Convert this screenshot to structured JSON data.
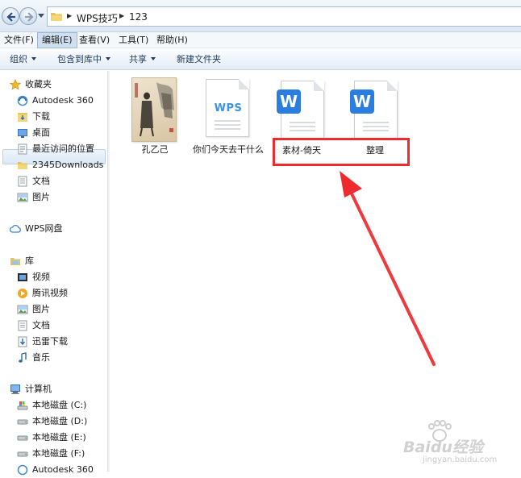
{
  "address": {
    "crumbs": [
      "WPS技巧",
      "123"
    ]
  },
  "menu": [
    {
      "label": "文件(F)"
    },
    {
      "label": "编辑(E)"
    },
    {
      "label": "查看(V)"
    },
    {
      "label": "工具(T)"
    },
    {
      "label": "帮助(H)"
    }
  ],
  "toolbar": {
    "organize": "组织",
    "include_library": "包含到库中",
    "share": "共享",
    "new_folder": "新建文件夹"
  },
  "sidebar": {
    "favorites": {
      "title": "收藏夹",
      "items": [
        "Autodesk 360",
        "下载",
        "桌面",
        "最近访问的位置",
        "2345Downloads",
        "文档",
        "图片"
      ]
    },
    "wps": "WPS网盘",
    "library": {
      "title": "库",
      "items": [
        "视频",
        "腾讯视频",
        "图片",
        "文档",
        "迅雷下载",
        "音乐"
      ]
    },
    "computer": {
      "title": "计算机",
      "items": [
        "本地磁盘 (C:)",
        "本地磁盘 (D:)",
        "本地磁盘 (E:)",
        "本地磁盘 (F:)",
        "Autodesk 360"
      ]
    }
  },
  "files": [
    {
      "name": "孔乙己",
      "kind": "image"
    },
    {
      "name": "你们今天去干什么",
      "kind": "wps-doc"
    },
    {
      "name": "素材-倚天",
      "kind": "word-doc"
    },
    {
      "name": "整理",
      "kind": "word-doc"
    }
  ],
  "colors": {
    "highlight": "#ee2a2f",
    "word_blue": "#2b7de0",
    "wps_blue": "#3c92e8"
  },
  "watermark": {
    "brand": "Baidu经验",
    "url": "jingyan.baidu.com"
  }
}
